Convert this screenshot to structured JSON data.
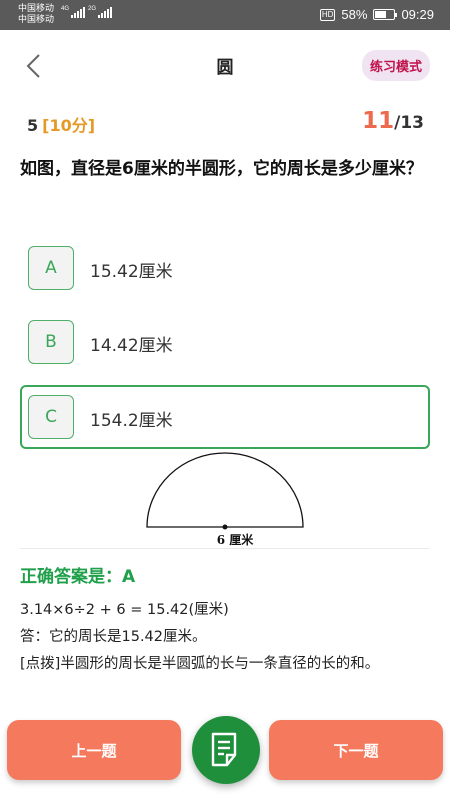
{
  "status_bar": {
    "carrier_1": "中国移动",
    "carrier_2": "中国移动",
    "network_1": "4G",
    "network_2": "2G",
    "hd": "HD",
    "battery": "58%",
    "battery_level": 0.58,
    "time": "09:29"
  },
  "header": {
    "back_icon": "chevron-left-icon",
    "title": "圆",
    "mode": "练习模式"
  },
  "meta": {
    "question_number": "5",
    "score": "[10分]",
    "current": "11",
    "total": "/13"
  },
  "question": {
    "text": "如图，直径是6厘米的半圆形，它的周长是多少厘米？"
  },
  "options": [
    {
      "letter": "A",
      "text": "15.42厘米",
      "selected": false
    },
    {
      "letter": "B",
      "text": "14.42厘米",
      "selected": false
    },
    {
      "letter": "C",
      "text": "154.2厘米",
      "selected": true
    }
  ],
  "figure": {
    "label": "6 厘米"
  },
  "answer": {
    "text": "正确答案是：A"
  },
  "explanation": {
    "formula": "3.14×6÷2 + 6 = 15.42(厘米)",
    "conclusion": "答：它的周长是15.42厘米。",
    "tip": "[点拨]半圆形的周长是半圆弧的长与一条直径的长的和。"
  },
  "bottom": {
    "prev": "上一题",
    "next": "下一题",
    "sheet_icon": "answer-sheet-icon"
  },
  "colors": {
    "accent_green": "#3aa659",
    "button_orange": "#f5795d",
    "fab_green": "#1f8f3c",
    "progress_red": "#ee6a4f",
    "score_orange": "#e59a27",
    "mode_text": "#c0124b"
  }
}
